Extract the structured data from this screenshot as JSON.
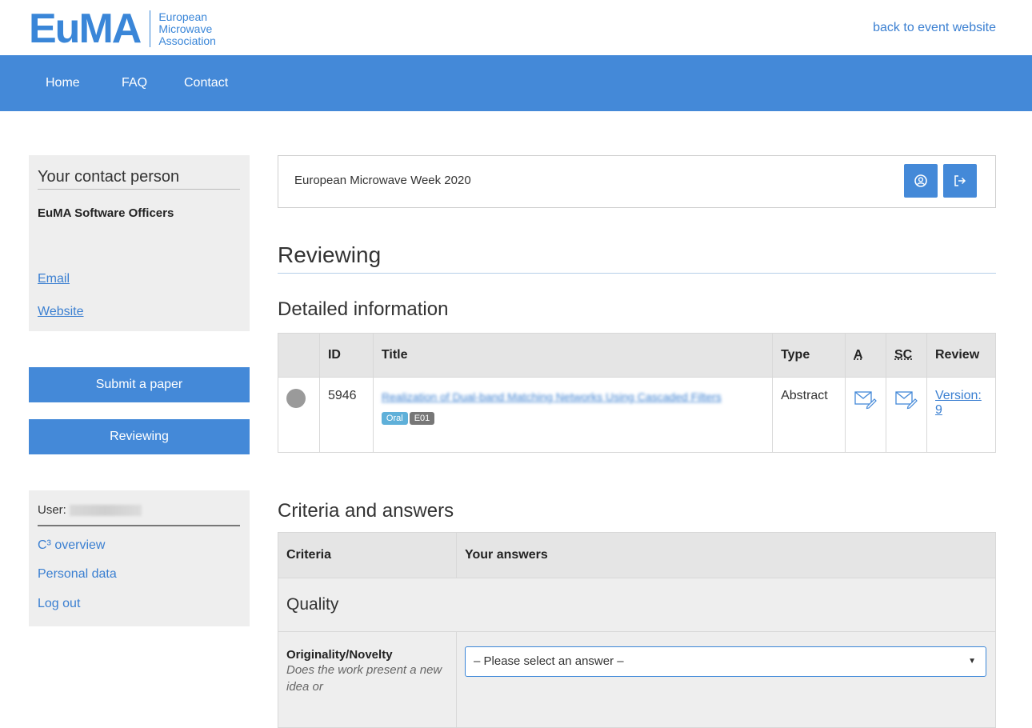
{
  "header": {
    "logo_mark": "EuMA",
    "logo_lines": [
      "European",
      "Microwave",
      "Association"
    ],
    "back_link": "back to event website"
  },
  "nav": {
    "items": [
      "Home",
      "FAQ",
      "Contact"
    ]
  },
  "contact": {
    "title": "Your contact person",
    "org": "EuMA Software Officers",
    "links": [
      "Email",
      "Website"
    ]
  },
  "side_buttons": [
    "Submit a paper",
    "Reviewing"
  ],
  "user_box": {
    "user_label": "User:",
    "links": [
      "C³ overview",
      "Personal data",
      "Log out"
    ]
  },
  "event": {
    "name": "European Microwave Week 2020"
  },
  "page": {
    "title": "Reviewing",
    "detailed_title": "Detailed information",
    "criteria_title": "Criteria and answers"
  },
  "info_table": {
    "headers": [
      "",
      "ID",
      "Title",
      "Type",
      "A",
      "SC",
      "Review"
    ],
    "row": {
      "id": "5946",
      "title": "Realization of Dual-band Matching Networks Using Cascaded Filters",
      "badges": [
        "Oral",
        "E01"
      ],
      "type": "Abstract",
      "review_link": "Version: 9"
    }
  },
  "criteria_table": {
    "headers": [
      "Criteria",
      "Your answers"
    ],
    "group": "Quality",
    "criterion": {
      "name": "Originality/Novelty",
      "description": "Does the work present a new idea or"
    },
    "select_value": "– Please select an answer –"
  },
  "colors": {
    "accent": "#4489d8",
    "link": "#3a7fd1"
  }
}
